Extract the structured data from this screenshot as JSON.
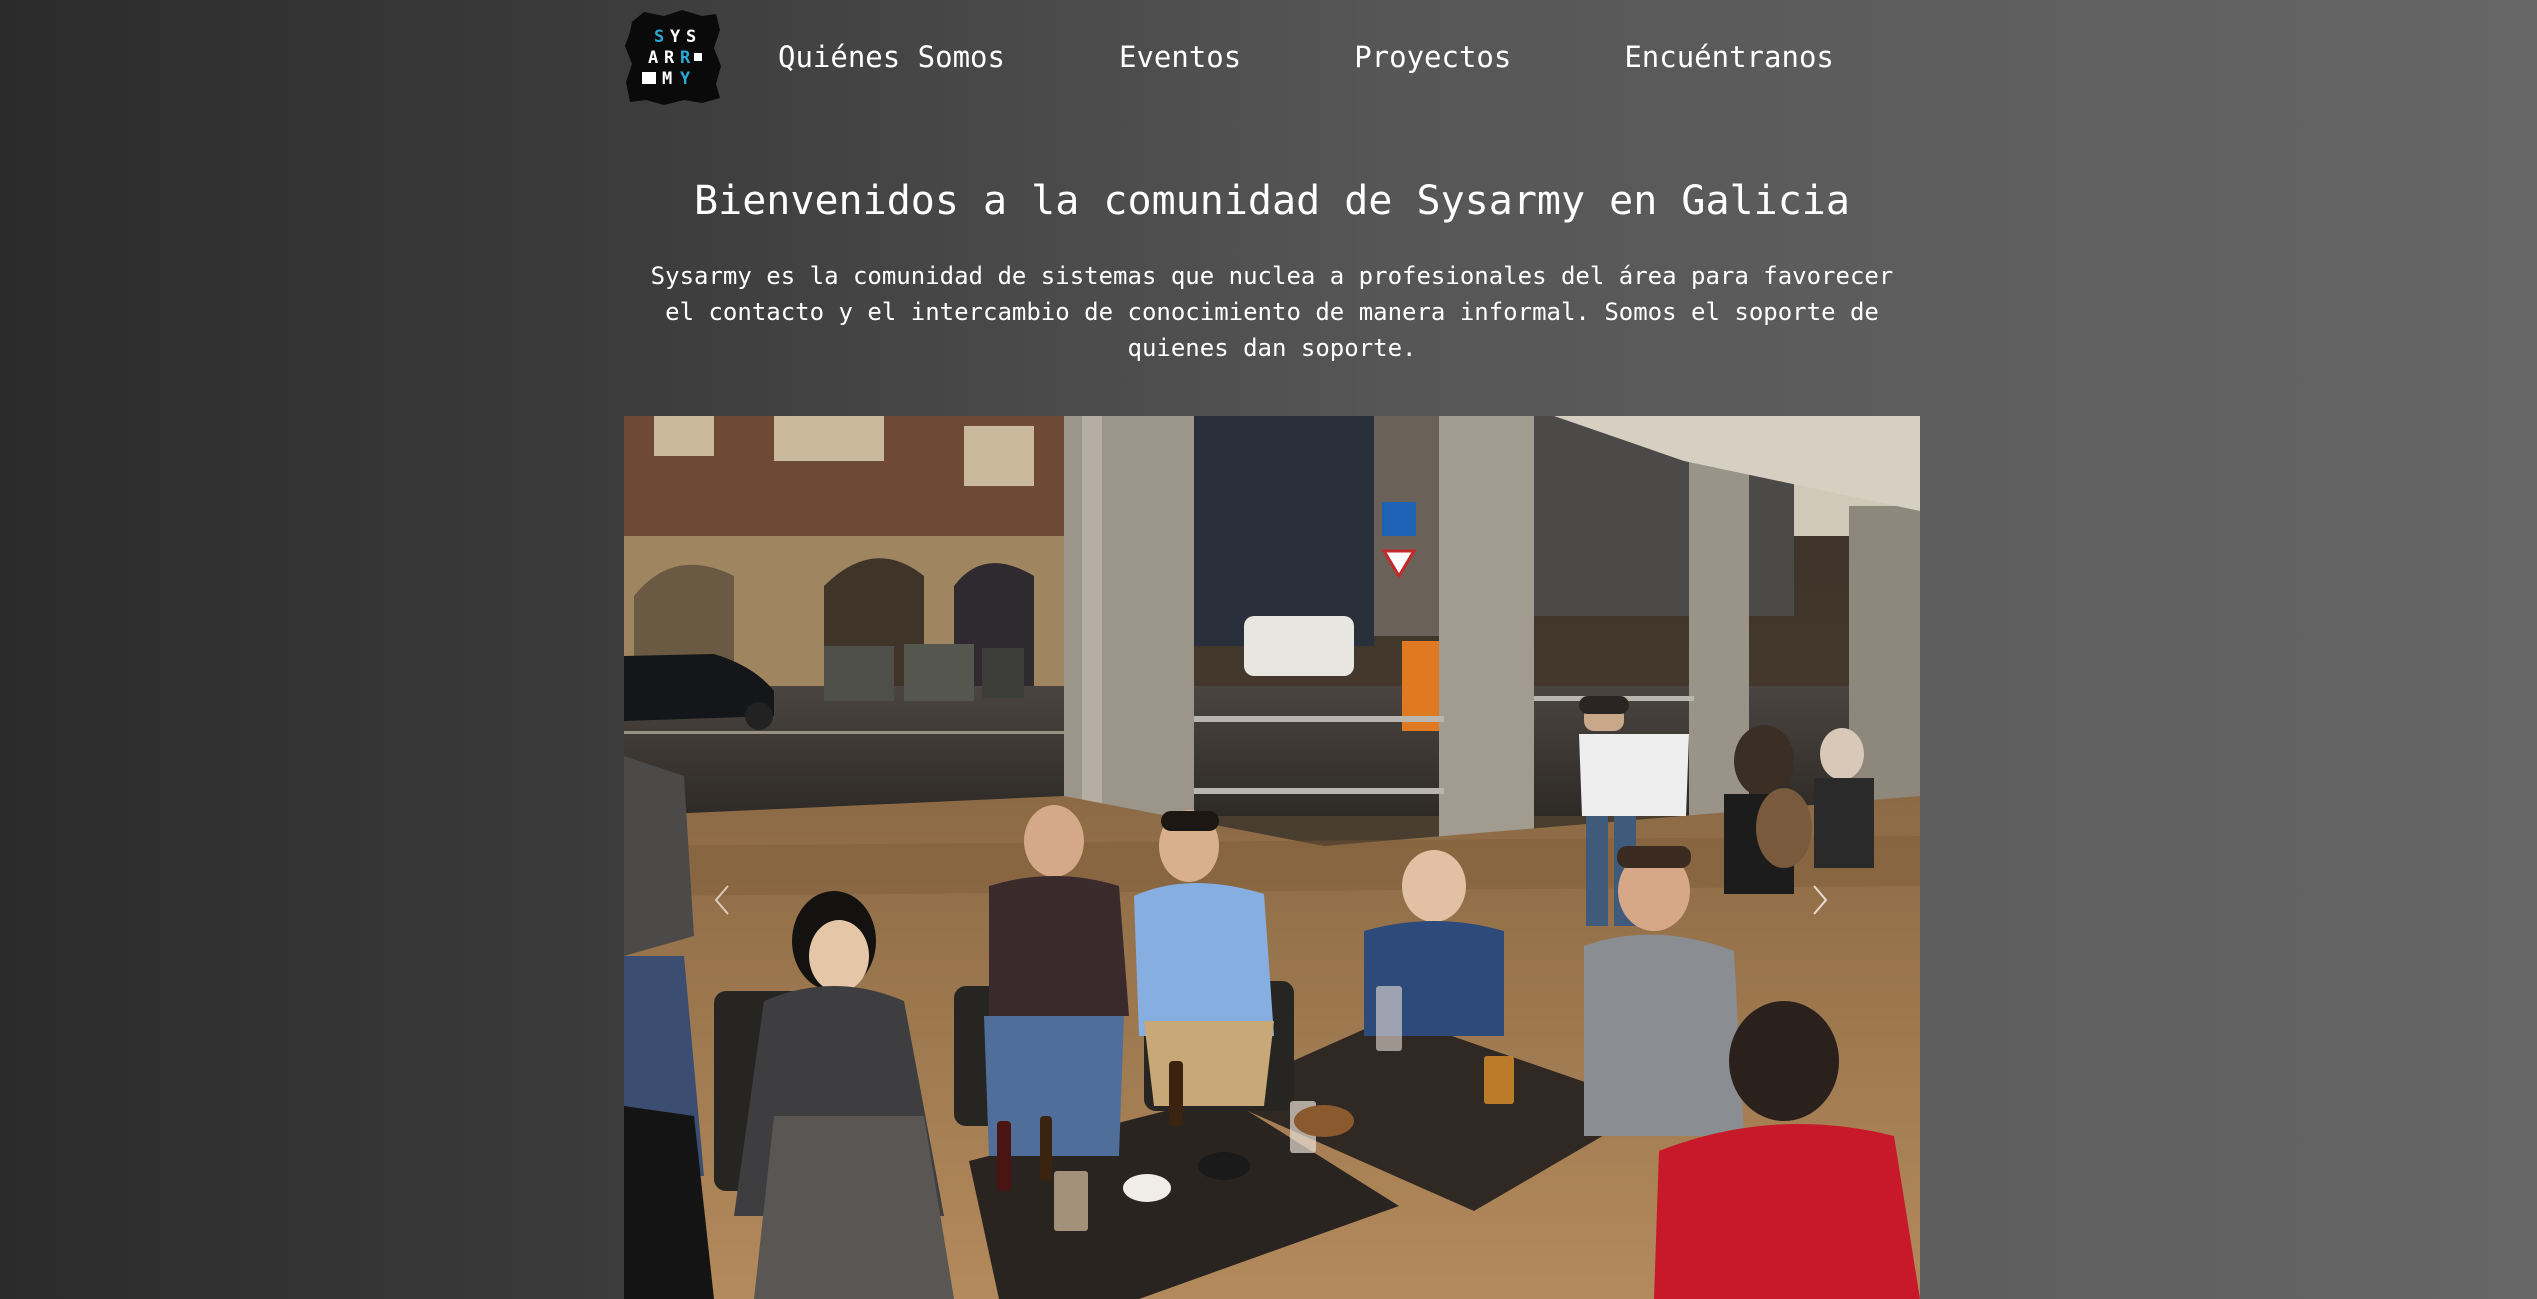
{
  "header": {
    "logo_text": "SYSARMY",
    "logo_icon": "sysarmy-logo",
    "nav": [
      {
        "label": "Quiénes Somos"
      },
      {
        "label": "Eventos"
      },
      {
        "label": "Proyectos"
      },
      {
        "label": "Encuéntranos"
      }
    ]
  },
  "main": {
    "title": "Bienvenidos a la comunidad de Sysarmy en Galicia",
    "intro": "Sysarmy es la comunidad de sistemas que nuclea a profesionales del área para favorecer el contacto y el intercambio de conocimiento de manera informal. Somos el soporte de quienes dan soporte."
  },
  "carousel": {
    "prev_icon": "chevron-left-icon",
    "next_icon": "chevron-right-icon"
  },
  "colors": {
    "logo_cyan": "#29a9d6",
    "background_left": "#2b2b2b",
    "background_right": "#666666",
    "text": "#ffffff"
  }
}
